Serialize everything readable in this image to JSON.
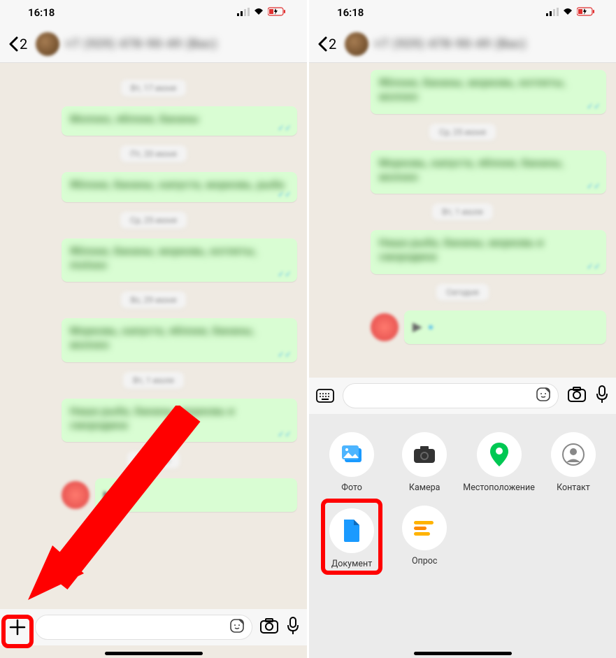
{
  "status": {
    "time": "16:18"
  },
  "header": {
    "back_count": "2",
    "contact_name": "+7 (929) 478-90-49 (Вас)"
  },
  "left": {
    "dates": [
      "Вт, 17 июня",
      "Пт, 20 июня",
      "Ср, 25 июня",
      "Вс, 29 июня",
      "Вт, 1 июля",
      "Сегодня"
    ],
    "msgs": [
      "Молоко, яблоки, бананы",
      "Яблоки, бананы, капуста, морковь, рыба",
      "Яблоки, бананы, морковь, котлеты, molоко",
      "Морковь, капуста, яблоки, бананы, молоко",
      "Наша рыба, бананы, морковь и смородина"
    ]
  },
  "right": {
    "dates": [
      "Ср, 25 июня",
      "Вт, 1 июля",
      "Сегодня"
    ],
    "msgs": [
      "Яблоки, бананы, морковь, котлеты, молоко",
      "Морковь, капуста, яблоки, бананы, молоко",
      "Наша рыба, бананы, морковь и смородина"
    ]
  },
  "attach": {
    "photo": "Фото",
    "camera": "Камера",
    "location": "Местоположение",
    "contact": "Контакт",
    "document": "Документ",
    "poll": "Опрос"
  }
}
